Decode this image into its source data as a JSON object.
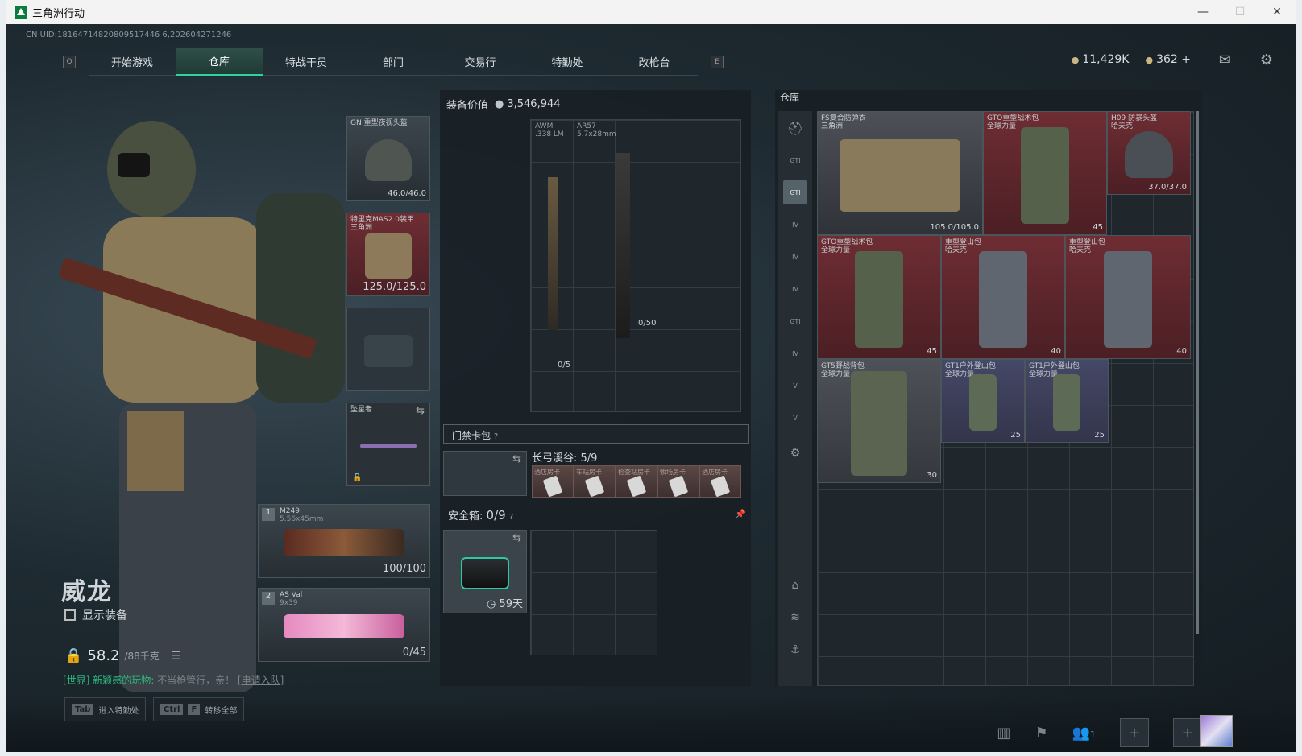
{
  "window": {
    "title": "三角洲行动",
    "minimize": "—",
    "maximize": "☐",
    "close": "✕"
  },
  "uid": "CN UID:18164714820809517446 6,202604271246",
  "nav": {
    "left_key": "Q",
    "right_key": "E",
    "tabs": [
      "开始游戏",
      "仓库",
      "特战干员",
      "部门",
      "交易行",
      "特勤处",
      "改枪台"
    ],
    "active_tab": "仓库"
  },
  "currency": {
    "silver": "11,429K",
    "gold": "362 +"
  },
  "icons": {
    "mail": "mail-icon",
    "settings": "gear-icon"
  },
  "operator": {
    "name": "威龙",
    "show_equipment": "显示装备",
    "weight": "58.2",
    "weight_max": "/88千克"
  },
  "chat": {
    "channel": "[世界]",
    "user": "新颖感的玩物:",
    "text": "不当枪管行，亲！",
    "link": "[申请入队]"
  },
  "hints": {
    "tab_key": "Tab",
    "tab_label": "进入特勤处",
    "ctrl_key": "Ctrl",
    "f_key": "F",
    "ctrl_label": "转移全部"
  },
  "slots": {
    "helmet": {
      "label": "GN 重型夜视头盔",
      "value": "46.0/46.0"
    },
    "armor": {
      "label": "特里克MAS2.0装甲\n三角洲",
      "value": "125.0/125.0"
    },
    "melee": {
      "label": "坠星者"
    },
    "primary": {
      "num": "1",
      "label": "M249",
      "caliber": "5.56x45mm",
      "value": "100/100"
    },
    "secondary": {
      "num": "2",
      "label": "AS Val",
      "caliber": "9x39",
      "value": "0/45"
    }
  },
  "mid": {
    "value_label": "装备价值",
    "value": "3,546,944",
    "weapons": [
      {
        "label": "AWM",
        "caliber": ".338 LM",
        "count": "0/5"
      },
      {
        "label": "AR57",
        "caliber": "5.7x28mm",
        "count": "0/50"
      }
    ],
    "keybag_label": "门禁卡包",
    "keybag_help": "?",
    "keybag_map": "长弓溪谷:",
    "keybag_count": "5/9",
    "keycards": [
      "酒店房卡",
      "车站房卡",
      "检查站房卡",
      "牧场房卡",
      "酒店房卡"
    ],
    "safebox_label": "安全箱:",
    "safebox_count": "0/9",
    "safebox_help": "?",
    "safebox_time": "59天"
  },
  "warehouse": {
    "title": "仓库",
    "side_icons": [
      "helmet-icon",
      "GTI",
      "GTI",
      "IV",
      "IV",
      "IV",
      "GTI",
      "IV",
      "V",
      "V",
      "gear-icon",
      "capsule-icon",
      "layers-icon",
      "anchor-icon"
    ],
    "items": [
      {
        "label": "FS复合防弹衣\n三角洲",
        "value": "105.0/105.0"
      },
      {
        "label": "GTO重型战术包\n全球力量",
        "value": "45"
      },
      {
        "label": "H09 防暴头盔\n哈夫克",
        "value": "37.0/37.0"
      },
      {
        "label": "GTO重型战术包\n全球力量",
        "value": "45"
      },
      {
        "label": "重型登山包\n哈夫克",
        "value": "40"
      },
      {
        "label": "重型登山包\n哈夫克",
        "value": "40"
      },
      {
        "label": "GT5野战背包\n全球力量",
        "value": "30"
      },
      {
        "label": "GT1户外登山包\n全球力量",
        "value": "25"
      },
      {
        "label": "GT1户外登山包\n全球力量",
        "value": "25"
      }
    ]
  },
  "bottom": {
    "squad_count": "1"
  }
}
